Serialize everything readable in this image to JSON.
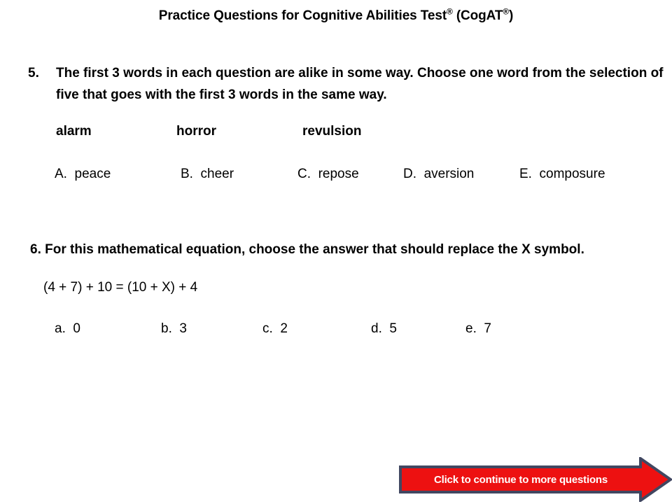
{
  "slide": {
    "title_prefix": "Practice Questions for Cognitive Abilities Test",
    "title_reg1": "®",
    "title_middle": " (CogAT",
    "title_reg2": "®",
    "title_suffix": ")",
    "title_plain": "Practice Questions for Cognitive Abilities Test® (CogAT®)"
  },
  "question5": {
    "number": "5.",
    "stem": "The first 3 words in each question are alike in some way.  Choose one word from the selection of five that goes with the first 3 words in the same way.",
    "prompt_words": [
      "alarm",
      "horror",
      "revulsion"
    ],
    "options": [
      {
        "letter": "A.",
        "text": "peace"
      },
      {
        "letter": "B.",
        "text": "cheer"
      },
      {
        "letter": "C.",
        "text": "repose"
      },
      {
        "letter": "D.",
        "text": "aversion"
      },
      {
        "letter": "E.",
        "text": "composure"
      }
    ]
  },
  "question6": {
    "stem": "6. For this mathematical equation, choose the answer that should replace the X symbol.",
    "equation": "(4 + 7) + 10 = (10 + X) + 4",
    "options": [
      {
        "letter": "a.",
        "text": "0"
      },
      {
        "letter": "b.",
        "text": "3"
      },
      {
        "letter": "c.",
        "text": "2"
      },
      {
        "letter": "d.",
        "text": "5"
      },
      {
        "letter": "e.",
        "text": "7"
      }
    ]
  },
  "continue_button": {
    "label": "Click to continue to more questions",
    "fill_color": "#ED1111",
    "border_color": "#414761",
    "text_color": "#FFFFFF"
  }
}
